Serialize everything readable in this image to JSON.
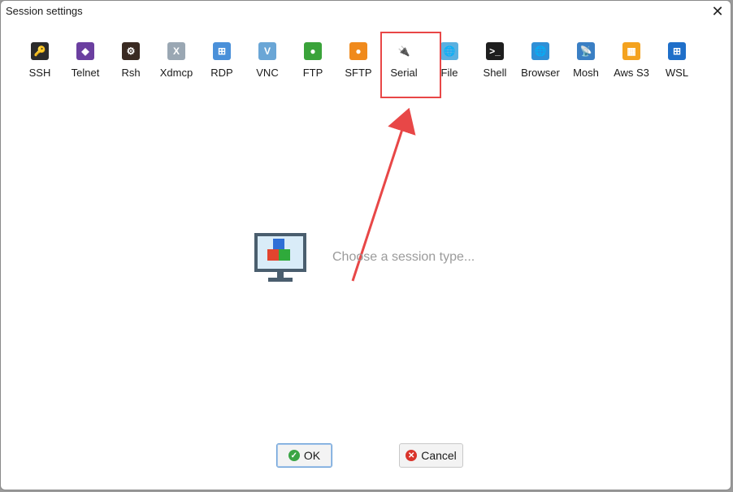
{
  "window": {
    "title": "Session settings",
    "close_glyph": "✕"
  },
  "session_types": [
    {
      "label": "SSH",
      "icon": "ssh-key-icon",
      "color": "#2b2b2b",
      "glyph": "🔑"
    },
    {
      "label": "Telnet",
      "icon": "telnet-gem-icon",
      "color": "#6b3fa0",
      "glyph": "◆"
    },
    {
      "label": "Rsh",
      "icon": "rsh-gears-icon",
      "color": "#3a2a22",
      "glyph": "⚙"
    },
    {
      "label": "Xdmcp",
      "icon": "xdmcp-x-icon",
      "color": "#9aa7b3",
      "glyph": "X"
    },
    {
      "label": "RDP",
      "icon": "rdp-monitor-icon",
      "color": "#4a90d9",
      "glyph": "⊞"
    },
    {
      "label": "VNC",
      "icon": "vnc-monitor-icon",
      "color": "#6aa6d6",
      "glyph": "V"
    },
    {
      "label": "FTP",
      "icon": "ftp-globe-icon",
      "color": "#3aa33a",
      "glyph": "●"
    },
    {
      "label": "SFTP",
      "icon": "sftp-globe-icon",
      "color": "#f08a1c",
      "glyph": "●"
    },
    {
      "label": "Serial",
      "icon": "serial-plug-icon",
      "color": "#ffffff",
      "glyph": "🔌"
    },
    {
      "label": "File",
      "icon": "file-monitor-icon",
      "color": "#5ab0e0",
      "glyph": "🌐"
    },
    {
      "label": "Shell",
      "icon": "shell-terminal-icon",
      "color": "#1e1e1e",
      "glyph": ">_"
    },
    {
      "label": "Browser",
      "icon": "browser-globe-icon",
      "color": "#2f8fd6",
      "glyph": "🌐"
    },
    {
      "label": "Mosh",
      "icon": "mosh-satellite-icon",
      "color": "#3a7fc4",
      "glyph": "📡"
    },
    {
      "label": "Aws S3",
      "icon": "aws-cubes-icon",
      "color": "#f4a21e",
      "glyph": "▦"
    },
    {
      "label": "WSL",
      "icon": "wsl-windows-icon",
      "color": "#1f6fc9",
      "glyph": "⊞"
    }
  ],
  "main": {
    "prompt": "Choose a session type..."
  },
  "buttons": {
    "ok_label": "OK",
    "cancel_label": "Cancel"
  },
  "colors": {
    "annotation_red": "#e84747",
    "ok_green": "#3aa545",
    "cancel_red": "#d9342b"
  }
}
